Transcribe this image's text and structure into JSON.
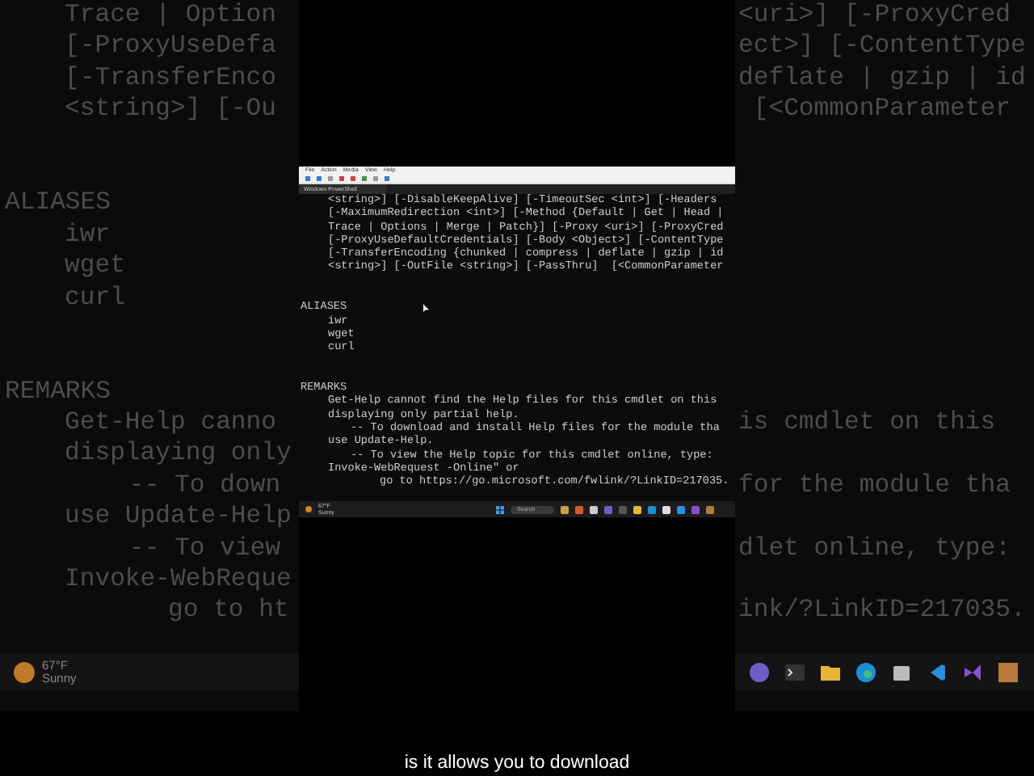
{
  "background": {
    "blocks": [
      [
        {
          "kind": "text",
          "left": "Trace | Option",
          "right": "<uri>] [-ProxyCred"
        },
        {
          "kind": "text",
          "left": "[-ProxyUseDefa",
          "right": "ect>] [-ContentType"
        },
        {
          "kind": "text",
          "left": "[-TransferEnco",
          "right": "deflate | gzip | id"
        },
        {
          "kind": "text",
          "left": "<string>] [-Ou",
          "right": " [<CommonParameter"
        }
      ],
      [
        {
          "kind": "heading",
          "left": "ALIASES"
        },
        {
          "kind": "text",
          "left": "iwr"
        },
        {
          "kind": "text",
          "left": "wget"
        },
        {
          "kind": "text",
          "left": "curl"
        }
      ],
      [
        {
          "kind": "heading",
          "left": "REMARKS"
        },
        {
          "kind": "text",
          "left": "Get-Help canno",
          "right": "is cmdlet on this"
        },
        {
          "kind": "text",
          "left": "displaying only"
        },
        {
          "kind": "sub",
          "left": "-- To down",
          "right": "for the module tha"
        },
        {
          "kind": "text",
          "left": "use Update-Help"
        },
        {
          "kind": "sub",
          "left": "-- To view",
          "right": "dlet online, type:"
        },
        {
          "kind": "text",
          "left": "Invoke-WebReque"
        },
        {
          "kind": "subsub",
          "left": "go to ht",
          "right": "ink/?LinkID=217035."
        }
      ]
    ],
    "taskbar": {
      "temperature": "67°F",
      "condition": "Sunny"
    }
  },
  "screen": {
    "menu": [
      "File",
      "Action",
      "Media",
      "View",
      "Help"
    ],
    "tab": {
      "title": "Windows PowerShell"
    },
    "blocks": [
      [
        {
          "kind": "text",
          "text": "<string>] [-DisableKeepAlive] [-TimeoutSec <int>] [-Headers"
        },
        {
          "kind": "text",
          "text": "[-MaximumRedirection <int>] [-Method {Default | Get | Head |"
        },
        {
          "kind": "text",
          "text": "Trace | Options | Merge | Patch}] [-Proxy <uri>] [-ProxyCred"
        },
        {
          "kind": "text",
          "text": "[-ProxyUseDefaultCredentials] [-Body <Object>] [-ContentType"
        },
        {
          "kind": "text",
          "text": "[-TransferEncoding {chunked | compress | deflate | gzip | id"
        },
        {
          "kind": "text",
          "text": "<string>] [-OutFile <string>] [-PassThru]  [<CommonParameter"
        }
      ],
      [
        {
          "kind": "heading",
          "text": "ALIASES"
        },
        {
          "kind": "text",
          "text": "iwr"
        },
        {
          "kind": "text",
          "text": "wget"
        },
        {
          "kind": "text",
          "text": "curl"
        }
      ],
      [
        {
          "kind": "heading",
          "text": "REMARKS"
        },
        {
          "kind": "text",
          "text": "Get-Help cannot find the Help files for this cmdlet on this"
        },
        {
          "kind": "text",
          "text": "displaying only partial help."
        },
        {
          "kind": "sub",
          "text": "-- To download and install Help files for the module tha"
        },
        {
          "kind": "text",
          "text": "use Update-Help."
        },
        {
          "kind": "sub",
          "text": "-- To view the Help topic for this cmdlet online, type:"
        },
        {
          "kind": "text",
          "text": "Invoke-WebRequest -Online\" or"
        },
        {
          "kind": "subsub",
          "text": "go to https://go.microsoft.com/fwlink/?LinkID=217035."
        }
      ]
    ],
    "taskbar": {
      "temperature": "67°F",
      "condition": "Sunny",
      "search": {
        "placeholder": "Search"
      }
    }
  },
  "caption": "is it allows you to download"
}
